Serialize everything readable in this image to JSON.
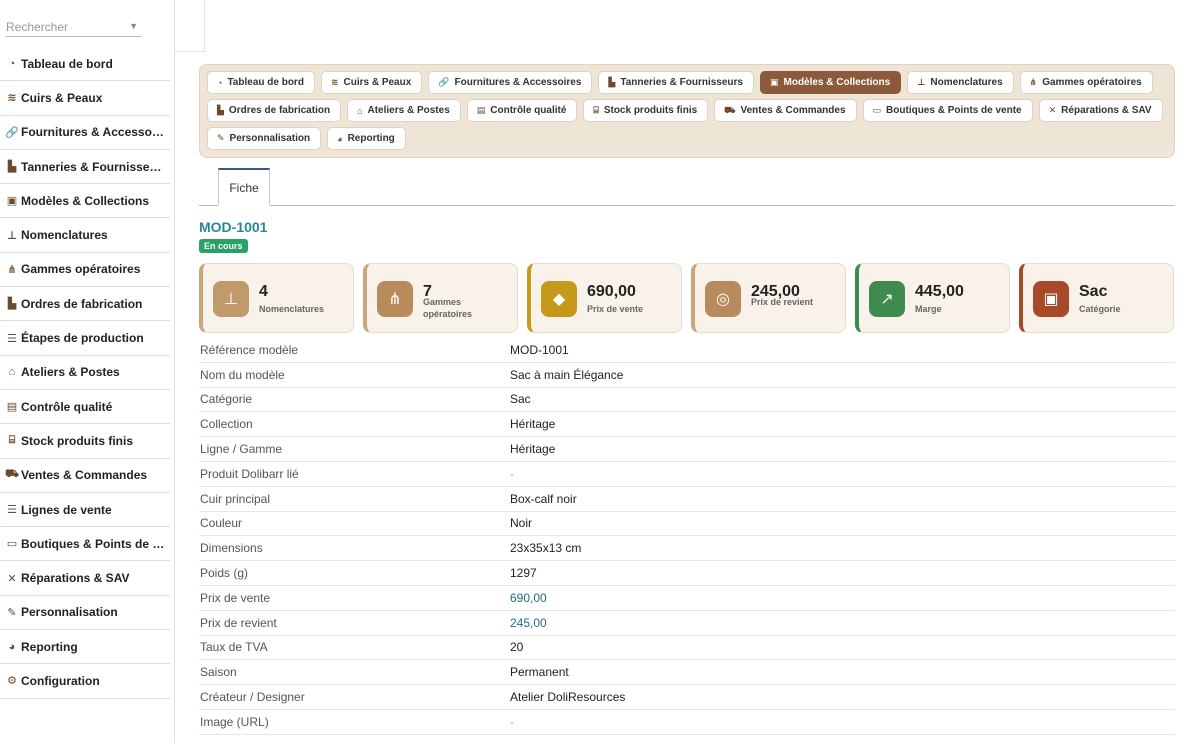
{
  "search": {
    "placeholder": "Rechercher"
  },
  "sidebar": {
    "items": [
      {
        "label": "Tableau de bord",
        "icon": "dashboard-icon"
      },
      {
        "label": "Cuirs & Peaux",
        "icon": "layers-icon"
      },
      {
        "label": "Fournitures & Accessoires",
        "icon": "link-icon"
      },
      {
        "label": "Tanneries & Fournisseurs",
        "icon": "factory-icon"
      },
      {
        "label": "Modèles & Collections",
        "icon": "bag-icon"
      },
      {
        "label": "Nomenclatures",
        "icon": "sitemap-icon"
      },
      {
        "label": "Gammes opératoires",
        "icon": "flow-icon"
      },
      {
        "label": "Ordres de fabrication",
        "icon": "factory-icon"
      },
      {
        "label": "Étapes de production",
        "icon": "list-icon"
      },
      {
        "label": "Ateliers & Postes",
        "icon": "workshop-icon"
      },
      {
        "label": "Contrôle qualité",
        "icon": "clipboard-icon"
      },
      {
        "label": "Stock produits finis",
        "icon": "warehouse-icon"
      },
      {
        "label": "Ventes & Commandes",
        "icon": "cart-icon"
      },
      {
        "label": "Lignes de vente",
        "icon": "list-icon"
      },
      {
        "label": "Boutiques & Points de vente",
        "icon": "store-icon"
      },
      {
        "label": "Réparations & SAV",
        "icon": "tools-icon"
      },
      {
        "label": "Personnalisation",
        "icon": "pen-icon"
      },
      {
        "label": "Reporting",
        "icon": "pie-icon"
      },
      {
        "label": "Configuration",
        "icon": "gear-icon"
      }
    ]
  },
  "tabs": {
    "row1": [
      {
        "label": "Tableau de bord",
        "icon": "dashboard-icon"
      },
      {
        "label": "Cuirs & Peaux",
        "icon": "layers-icon"
      },
      {
        "label": "Fournitures & Accessoires",
        "icon": "link-icon"
      },
      {
        "label": "Tanneries & Fournisseurs",
        "icon": "factory-icon"
      },
      {
        "label": "Modèles & Collections",
        "icon": "bag-icon",
        "active": true
      },
      {
        "label": "Nomenclatures",
        "icon": "sitemap-icon"
      },
      {
        "label": "Gammes opératoires",
        "icon": "flow-icon"
      }
    ],
    "row2": [
      {
        "label": "Ordres de fabrication",
        "icon": "factory-icon"
      },
      {
        "label": "Ateliers & Postes",
        "icon": "workshop-icon"
      },
      {
        "label": "Contrôle qualité",
        "icon": "clipboard-icon"
      },
      {
        "label": "Stock produits finis",
        "icon": "warehouse-icon"
      },
      {
        "label": "Ventes & Commandes",
        "icon": "cart-icon"
      },
      {
        "label": "Boutiques & Points de vente",
        "icon": "store-icon"
      },
      {
        "label": "Réparations & SAV",
        "icon": "tools-icon"
      }
    ],
    "row3": [
      {
        "label": "Personnalisation",
        "icon": "pen-icon"
      },
      {
        "label": "Reporting",
        "icon": "pie-icon"
      }
    ]
  },
  "subtab": {
    "label": "Fiche"
  },
  "record": {
    "reference": "MOD-1001",
    "status": "En cours",
    "status_color": "#27a36a"
  },
  "cards": [
    {
      "value": "4",
      "label": "Nomenclatures",
      "icon": "sitemap-icon",
      "color": "#c19a6b",
      "border": "#c8a57a"
    },
    {
      "value": "7",
      "label": "Gammes opératoires",
      "icon": "flow-icon",
      "color": "#b88a5c",
      "border": "#c8a57a"
    },
    {
      "value": "690,00",
      "label": "Prix de vente",
      "icon": "tag-icon",
      "color": "#c59a1a",
      "border": "#c59a1a"
    },
    {
      "value": "245,00",
      "label": "Prix de revient",
      "icon": "coins-icon",
      "color": "#b88a5c",
      "border": "#c8a57a"
    },
    {
      "value": "445,00",
      "label": "Marge",
      "icon": "chart-icon",
      "color": "#3f8a4f",
      "border": "#3f8a4f"
    },
    {
      "value": "Sac",
      "label": "Catégorie",
      "icon": "bag-icon",
      "color": "#a64a2a",
      "border": "#a64a2a"
    }
  ],
  "details": [
    {
      "key": "Référence modèle",
      "value": "MOD-1001"
    },
    {
      "key": "Nom du modèle",
      "value": "Sac à main Élégance"
    },
    {
      "key": "Catégorie",
      "value": "Sac"
    },
    {
      "key": "Collection",
      "value": "Héritage"
    },
    {
      "key": "Ligne / Gamme",
      "value": "Héritage"
    },
    {
      "key": "Produit Dolibarr lié",
      "value": "-",
      "style": "muted"
    },
    {
      "key": "Cuir principal",
      "value": "Box-calf noir"
    },
    {
      "key": "Couleur",
      "value": "Noir"
    },
    {
      "key": "Dimensions",
      "value": "23x35x13 cm"
    },
    {
      "key": "Poids (g)",
      "value": "1297"
    },
    {
      "key": "Prix de vente",
      "value": "690,00",
      "style": "link"
    },
    {
      "key": "Prix de revient",
      "value": "245,00",
      "style": "link"
    },
    {
      "key": "Taux de TVA",
      "value": "20"
    },
    {
      "key": "Saison",
      "value": "Permanent"
    },
    {
      "key": "Créateur / Designer",
      "value": "Atelier DoliResources"
    },
    {
      "key": "Image (URL)",
      "value": "-",
      "style": "muted"
    }
  ]
}
